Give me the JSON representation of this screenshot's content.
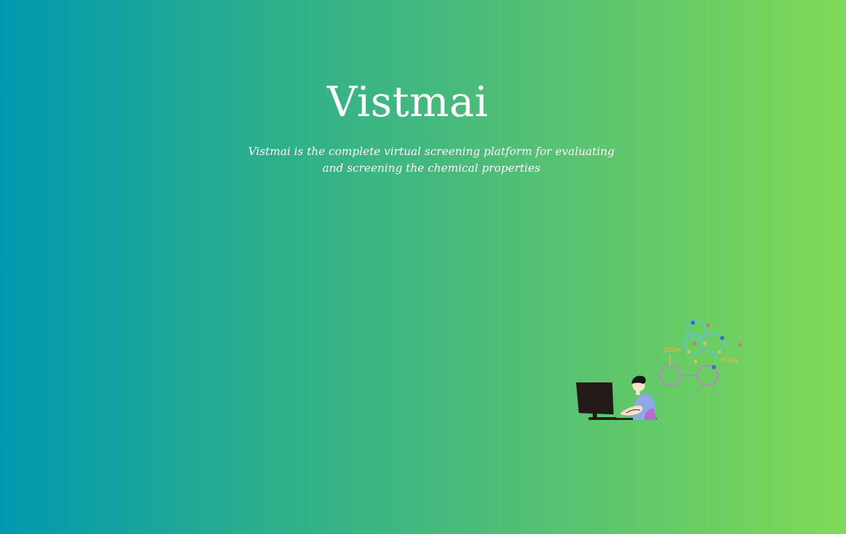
{
  "hero": {
    "title": "Vistmai",
    "tagline": "Vistmai is the complete virtual screening platform for evaluating and screening the chemical properties"
  },
  "illustration": {
    "icon": "scientist-at-computer-with-molecule-illustration",
    "molecule_labels": [
      "(Cl)n",
      "(Cl)n"
    ]
  },
  "colors": {
    "gradient_start": "#0199b1",
    "gradient_end": "#80da55",
    "text": "#ffffff"
  }
}
